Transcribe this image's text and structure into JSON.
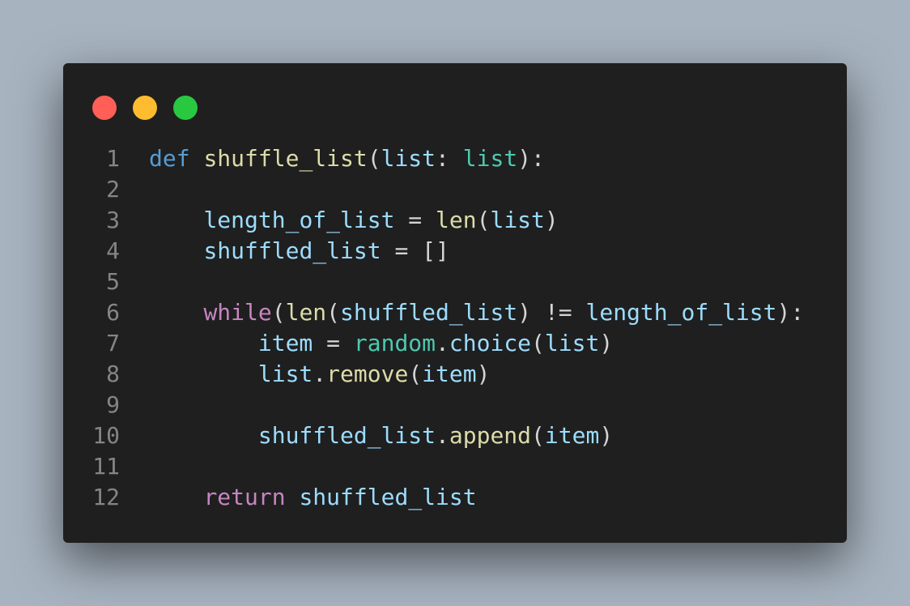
{
  "window": {
    "controls": [
      {
        "name": "close",
        "color": "#ff5f57"
      },
      {
        "name": "minimize",
        "color": "#febc2e"
      },
      {
        "name": "maximize",
        "color": "#28c840"
      }
    ]
  },
  "code": {
    "language": "python",
    "lines": [
      {
        "number": "1",
        "tokens": [
          {
            "t": "def",
            "c": "kw"
          },
          {
            "t": " ",
            "c": "op"
          },
          {
            "t": "shuffle_list",
            "c": "fn"
          },
          {
            "t": "(",
            "c": "op"
          },
          {
            "t": "list",
            "c": "var"
          },
          {
            "t": ": ",
            "c": "op"
          },
          {
            "t": "list",
            "c": "typ"
          },
          {
            "t": "):",
            "c": "op"
          }
        ]
      },
      {
        "number": "2",
        "tokens": []
      },
      {
        "number": "3",
        "tokens": [
          {
            "t": "    ",
            "c": "op"
          },
          {
            "t": "length_of_list",
            "c": "var"
          },
          {
            "t": " = ",
            "c": "op"
          },
          {
            "t": "len",
            "c": "fn"
          },
          {
            "t": "(",
            "c": "op"
          },
          {
            "t": "list",
            "c": "var"
          },
          {
            "t": ")",
            "c": "op"
          }
        ]
      },
      {
        "number": "4",
        "tokens": [
          {
            "t": "    ",
            "c": "op"
          },
          {
            "t": "shuffled_list",
            "c": "var"
          },
          {
            "t": " = []",
            "c": "op"
          }
        ]
      },
      {
        "number": "5",
        "tokens": []
      },
      {
        "number": "6",
        "tokens": [
          {
            "t": "    ",
            "c": "op"
          },
          {
            "t": "while",
            "c": "ctl"
          },
          {
            "t": "(",
            "c": "op"
          },
          {
            "t": "len",
            "c": "fn"
          },
          {
            "t": "(",
            "c": "op"
          },
          {
            "t": "shuffled_list",
            "c": "var"
          },
          {
            "t": ") != ",
            "c": "op"
          },
          {
            "t": "length_of_list",
            "c": "var"
          },
          {
            "t": "):",
            "c": "op"
          }
        ]
      },
      {
        "number": "7",
        "tokens": [
          {
            "t": "        ",
            "c": "op"
          },
          {
            "t": "item",
            "c": "var"
          },
          {
            "t": " = ",
            "c": "op"
          },
          {
            "t": "random",
            "c": "typ"
          },
          {
            "t": ".",
            "c": "op"
          },
          {
            "t": "choice",
            "c": "var"
          },
          {
            "t": "(",
            "c": "op"
          },
          {
            "t": "list",
            "c": "var"
          },
          {
            "t": ")",
            "c": "op"
          }
        ]
      },
      {
        "number": "8",
        "tokens": [
          {
            "t": "        ",
            "c": "op"
          },
          {
            "t": "list",
            "c": "var"
          },
          {
            "t": ".",
            "c": "op"
          },
          {
            "t": "remove",
            "c": "fn"
          },
          {
            "t": "(",
            "c": "op"
          },
          {
            "t": "item",
            "c": "var"
          },
          {
            "t": ")",
            "c": "op"
          }
        ]
      },
      {
        "number": "9",
        "tokens": []
      },
      {
        "number": "10",
        "tokens": [
          {
            "t": "        ",
            "c": "op"
          },
          {
            "t": "shuffled_list",
            "c": "var"
          },
          {
            "t": ".",
            "c": "op"
          },
          {
            "t": "append",
            "c": "fn"
          },
          {
            "t": "(",
            "c": "op"
          },
          {
            "t": "item",
            "c": "var"
          },
          {
            "t": ")",
            "c": "op"
          }
        ]
      },
      {
        "number": "11",
        "tokens": []
      },
      {
        "number": "12",
        "tokens": [
          {
            "t": "    ",
            "c": "op"
          },
          {
            "t": "return",
            "c": "ctl"
          },
          {
            "t": " ",
            "c": "op"
          },
          {
            "t": "shuffled_list",
            "c": "var"
          }
        ]
      }
    ]
  }
}
